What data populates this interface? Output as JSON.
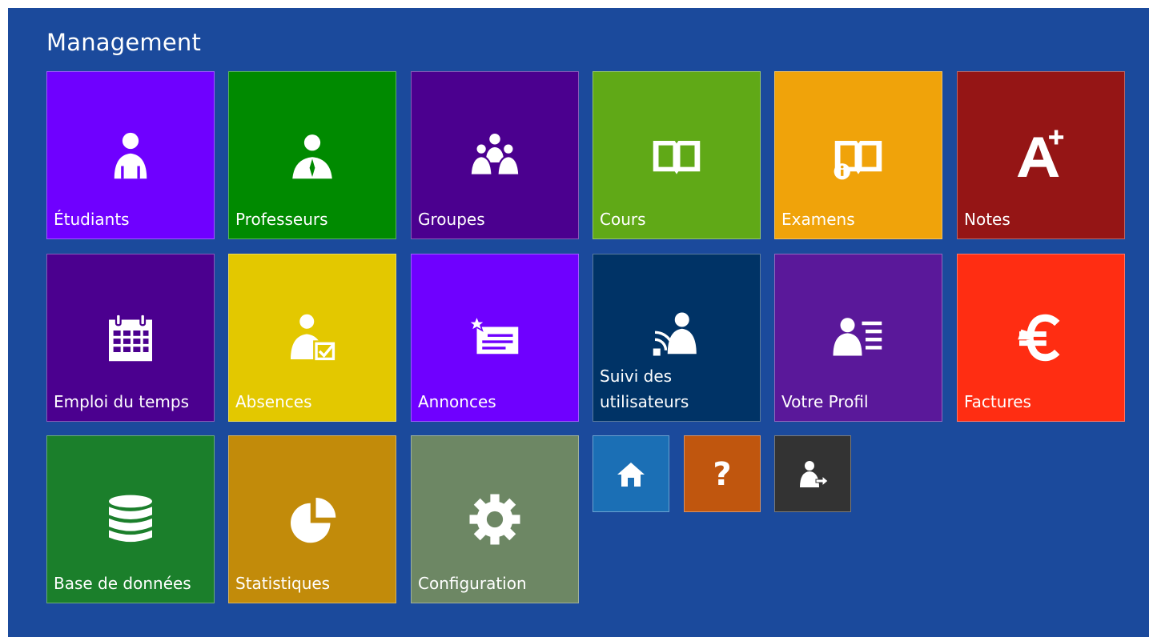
{
  "page": {
    "title": "Management",
    "background": "#1b4a9c"
  },
  "tiles": [
    {
      "label": "Étudiants",
      "icon": "student-icon",
      "color": "#6f00ff"
    },
    {
      "label": "Professeurs",
      "icon": "teacher-icon",
      "color": "#008a00"
    },
    {
      "label": "Groupes",
      "icon": "group-icon",
      "color": "#4b008f"
    },
    {
      "label": "Cours",
      "icon": "book-icon",
      "color": "#60a917"
    },
    {
      "label": "Examens",
      "icon": "exam-book-icon",
      "color": "#f0a30a"
    },
    {
      "label": "Notes",
      "icon": "grade-a-plus-icon",
      "color": "#951515"
    },
    {
      "label": "Emploi du temps",
      "icon": "calendar-icon",
      "color": "#4b008f"
    },
    {
      "label": "Absences",
      "icon": "attendance-check-icon",
      "color": "#e3c800"
    },
    {
      "label": "Annonces",
      "icon": "announcement-icon",
      "color": "#6f00ff"
    },
    {
      "label": "Suivi des utilisateurs",
      "icon": "user-tracking-icon",
      "color": "#003366"
    },
    {
      "label": "Votre Profil",
      "icon": "profile-card-icon",
      "color": "#5a189a"
    },
    {
      "label": "Factures",
      "icon": "euro-icon",
      "color": "#ff2d12"
    },
    {
      "label": "Base de données",
      "icon": "database-icon",
      "color": "#1b7f2b"
    },
    {
      "label": "Statistiques",
      "icon": "pie-chart-icon",
      "color": "#c28b0a"
    },
    {
      "label": "Configuration",
      "icon": "gear-icon",
      "color": "#6d8764"
    }
  ],
  "shortcuts": [
    {
      "name": "home",
      "icon": "home-icon",
      "color": "#1b6fb5"
    },
    {
      "name": "help",
      "icon": "question-icon",
      "color": "#c0560e",
      "glyph": "?"
    },
    {
      "name": "logout",
      "icon": "logout-icon",
      "color": "#333333"
    }
  ]
}
